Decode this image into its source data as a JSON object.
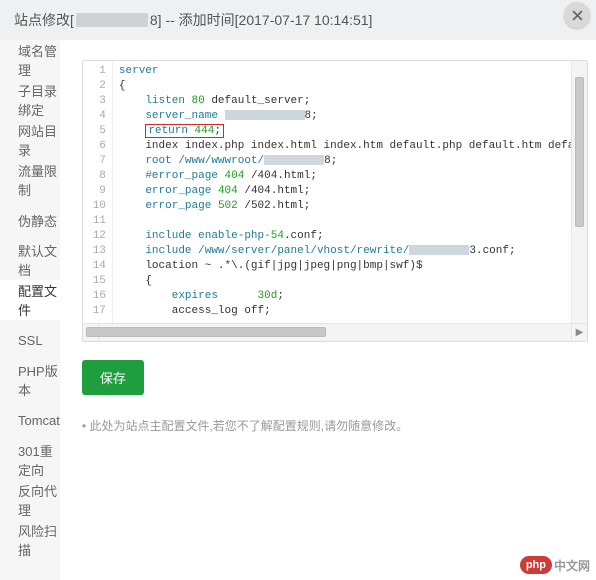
{
  "header": {
    "prefix": "站点修改[",
    "suffix_after_redact": "8] -- 添加时间[2017-07-17 10:14:51]"
  },
  "sidebar": {
    "items": [
      {
        "label": "域名管理"
      },
      {
        "label": "子目录绑定"
      },
      {
        "label": "网站目录"
      },
      {
        "label": "流量限制"
      },
      {
        "label": "伪静态"
      },
      {
        "label": "默认文档"
      },
      {
        "label": "配置文件",
        "active": true
      },
      {
        "label": "SSL"
      },
      {
        "label": "PHP版本"
      },
      {
        "label": "Tomcat"
      },
      {
        "label": "301重定向"
      },
      {
        "label": "反向代理"
      },
      {
        "label": "风险扫描"
      }
    ]
  },
  "editor": {
    "line_count": 17,
    "lines": {
      "l1": "server",
      "l2": "{",
      "l3_a": "listen ",
      "l3_b": "80",
      "l3_c": " default_server;",
      "l4_a": "server_name ",
      "l4_b": "8",
      "l4_c": ";",
      "l5_a": "return ",
      "l5_b": "444",
      "l5_c": ";",
      "l6": "index index.php index.html index.htm default.php default.htm defau",
      "l7_a": "root /www/wwwroot/",
      "l7_b": "8",
      "l7_c": ";",
      "l8_a": "#error_page ",
      "l8_b": "404",
      "l8_c": " /404.html;",
      "l9_a": "error_page ",
      "l9_b": "404",
      "l9_c": " /404.html;",
      "l10_a": "error_page ",
      "l10_b": "502",
      "l10_c": " /502.html;",
      "l12_a": "include enable-php-",
      "l12_b": "54",
      "l12_c": ".conf;",
      "l13_a": "include /www/server/panel/vhost/rewrite/",
      "l13_b": "3",
      "l13_c": ".conf;",
      "l14": "location ~ .*\\.(gif|jpg|jpeg|png|bmp|swf)$",
      "l15": "{",
      "l16_a": "expires      ",
      "l16_b": "30d",
      "l16_c": ";",
      "l17": "access_log off;"
    }
  },
  "buttons": {
    "save": "保存"
  },
  "hint": "此处为站点主配置文件,若您不了解配置规则,请勿随意修改。",
  "watermark": {
    "pill": "php",
    "text": "中文网"
  }
}
